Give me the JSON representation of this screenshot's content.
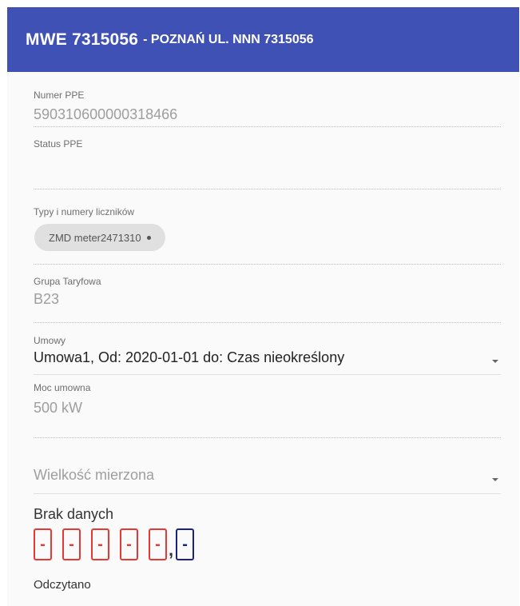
{
  "header": {
    "meter_code": "MWE 7315056",
    "location": "- POZNAŃ UL. NNN 7315056"
  },
  "fields": {
    "ppe_number": {
      "label": "Numer PPE",
      "value": "590310600000318466"
    },
    "ppe_status": {
      "label": "Status PPE",
      "value": ""
    },
    "meters": {
      "label": "Typy i numery liczników",
      "chip": "ZMD meter2471310"
    },
    "tariff_group": {
      "label": "Grupa Taryfowa",
      "value": "B23"
    },
    "contracts": {
      "label": "Umowy",
      "value": "Umowa1, Od: 2020-01-01 do: Czas nieokreślony"
    },
    "contract_power": {
      "label": "Moc umowna",
      "value": "500 kW"
    },
    "measured_quantity": {
      "placeholder": "Wielkość mierzona"
    }
  },
  "reading": {
    "status": "Brak danych",
    "integer_digits": [
      "-",
      "-",
      "-",
      "-",
      "-"
    ],
    "decimal_separator": ",",
    "decimal_digits": [
      "-"
    ],
    "caption": "Odczytano"
  },
  "colors": {
    "header_bg": "#3f51b5",
    "digit_border": "#e53935",
    "decimal_border": "#1a237e"
  }
}
